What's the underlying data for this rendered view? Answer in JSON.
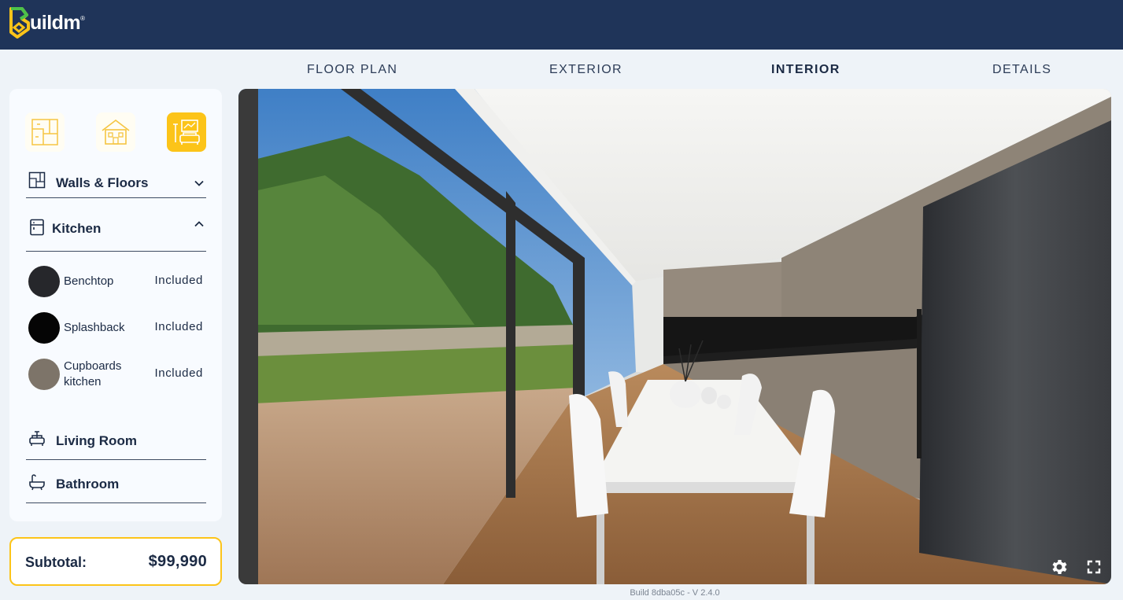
{
  "brand": {
    "logo_text": "uildm",
    "logo_mark": "B",
    "trademark": "®"
  },
  "tabs": [
    {
      "label": "FLOOR PLAN",
      "active": false
    },
    {
      "label": "EXTERIOR",
      "active": false
    },
    {
      "label": "INTERIOR",
      "active": true
    },
    {
      "label": "DETAILS",
      "active": false
    }
  ],
  "categories": [
    {
      "icon": "floor-plan-icon",
      "active": false
    },
    {
      "icon": "house-exterior-icon",
      "active": false
    },
    {
      "icon": "interior-room-icon",
      "active": true
    }
  ],
  "sections": {
    "walls_floors": {
      "label": "Walls & Floors",
      "icon": "walls-floors-icon",
      "expanded": false
    },
    "kitchen": {
      "label": "Kitchen",
      "icon": "kitchen-icon",
      "expanded": true
    },
    "living_room": {
      "label": "Living Room",
      "icon": "sofa-icon",
      "expanded": false
    },
    "bathroom": {
      "label": "Bathroom",
      "icon": "bathtub-icon",
      "expanded": false
    }
  },
  "kitchen_items": [
    {
      "name": "Benchtop",
      "status": "Included",
      "color": "#26272b"
    },
    {
      "name": "Splashback",
      "status": "Included",
      "color": "#050505"
    },
    {
      "name": "Cupboards kitchen",
      "status": "Included",
      "color": "#7d7469"
    }
  ],
  "subtotal": {
    "label": "Subtotal:",
    "value": "$99,990"
  },
  "viewer": {
    "settings_icon": "gear-icon",
    "fullscreen_icon": "fullscreen-icon"
  },
  "footer": {
    "build": "Build 8dba05c - V 2.4.0"
  },
  "colors": {
    "header": "#1f3459",
    "accent": "#fcc419",
    "panel": "#f8fbff",
    "page": "#eef3f8"
  }
}
